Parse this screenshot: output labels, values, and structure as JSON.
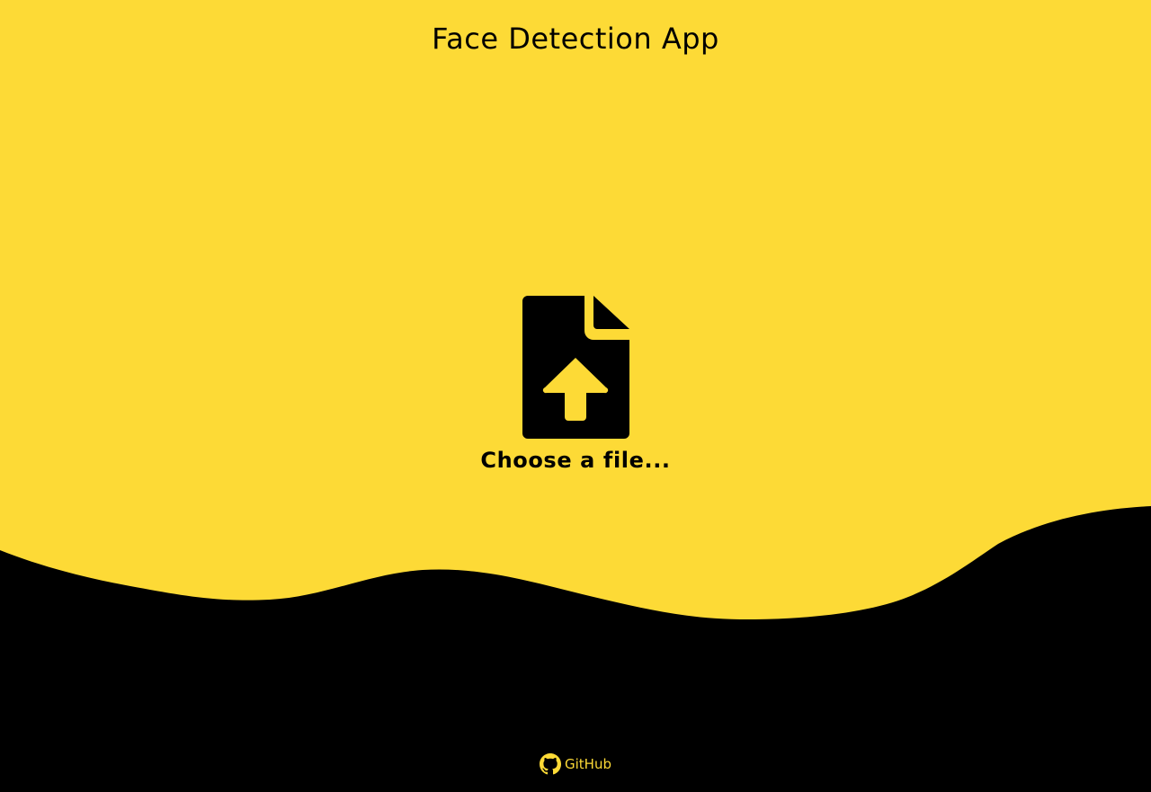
{
  "app": {
    "title": "Face Detection App"
  },
  "upload": {
    "label": "Choose a file...",
    "icon": "file-upload-icon"
  },
  "footer": {
    "link_label": "GitHub",
    "icon": "github-icon"
  },
  "colors": {
    "background": "#FDDA36",
    "wave": "#000000",
    "text": "#000000",
    "footer_text": "#FDDA36"
  }
}
